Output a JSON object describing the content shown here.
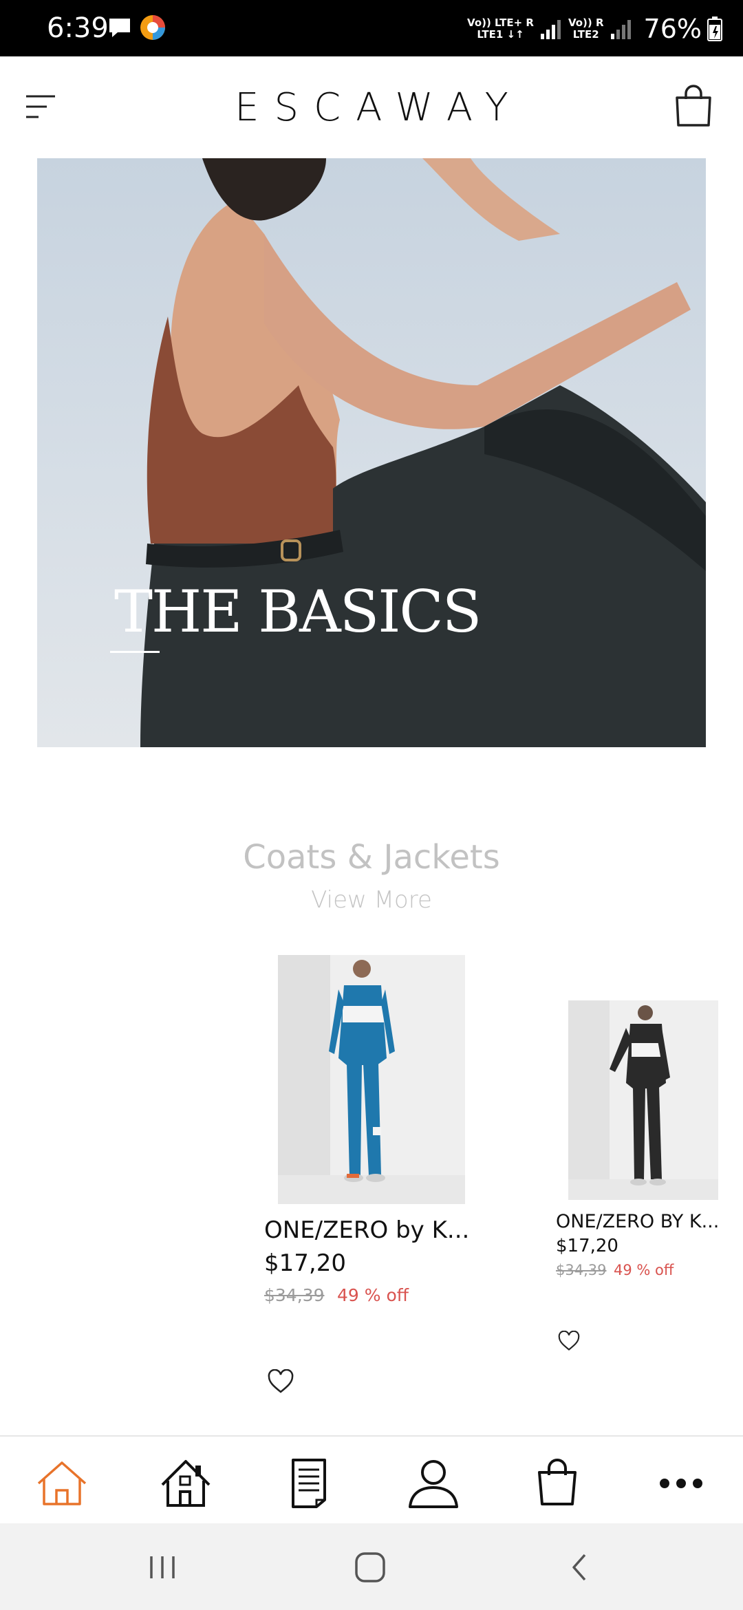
{
  "status_bar": {
    "time": "6:39",
    "sim1_top": "Vo)) LTE+ R",
    "sim1_bottom": "LTE1 ↓↑",
    "sim2_top": "Vo)) R",
    "sim2_bottom": "LTE2",
    "battery": "76%"
  },
  "header": {
    "brand": "ESCAWAY"
  },
  "hero": {
    "title": "THE BASICS"
  },
  "section": {
    "title": "Coats & Jackets",
    "view_more": "View More"
  },
  "products": [
    {
      "name": "ONE/ZERO by K...",
      "price": "$17,20",
      "old_price": "$34,39",
      "discount": "49 % off",
      "color": "#1f78ad"
    },
    {
      "name": "ONE/ZERO BY K...",
      "price": "$17,20",
      "old_price": "$34,39",
      "discount": "49 % off",
      "color": "#2a2a2a"
    }
  ],
  "bottom_nav": {
    "items": [
      "home-outline-icon",
      "house-icon",
      "document-icon",
      "profile-icon",
      "shopping-bag-icon",
      "more-icon"
    ],
    "active_color": "#e8732a"
  },
  "system_nav": [
    "recents-icon",
    "home-button-icon",
    "back-icon"
  ]
}
